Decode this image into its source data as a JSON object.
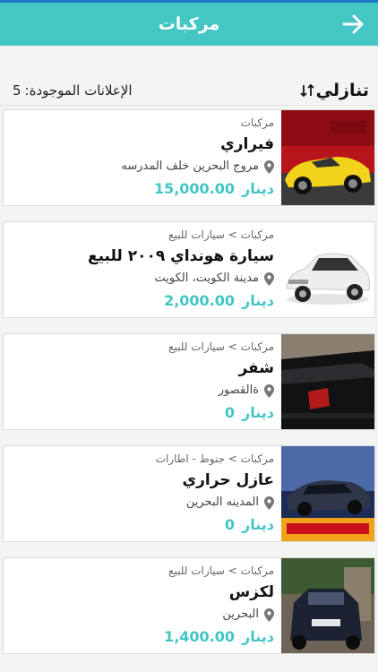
{
  "header": {
    "title": "مركبات",
    "back_icon": "arrow-right-icon"
  },
  "subbar": {
    "sort_label": "تنازلي",
    "sort_icon": "sort-arrows-icon",
    "count_label": "الإعلانات الموجودة:",
    "count_value": "5"
  },
  "colors": {
    "accent": "#43c6c4",
    "status_bar": "#1e73c8"
  },
  "listings": [
    {
      "category": "مركبات",
      "title": "فيراري",
      "location": "مروج البحرين خلف المدرسه",
      "currency": "دينار",
      "price": "15,000.00"
    },
    {
      "category": "مركبات > سيارات للبيع",
      "title": "سيارة هونداي ٢٠٠٩ للبيع",
      "location": "مدينة الكويت، الكويت",
      "currency": "دينار",
      "price": "2,000.00"
    },
    {
      "category": "مركبات > سيارات للبيع",
      "title": "شفر",
      "location": "ةالقصور",
      "currency": "دينار",
      "price": "0"
    },
    {
      "category": "مركبات > جنوط - اطارات",
      "title": "عازل حراري",
      "location": "المدينه البحرين",
      "currency": "دينار",
      "price": "0"
    },
    {
      "category": "مركبات > سيارات للبيع",
      "title": "لكزس",
      "location": "البحرين",
      "currency": "دينار",
      "price": "1,400.00"
    }
  ]
}
